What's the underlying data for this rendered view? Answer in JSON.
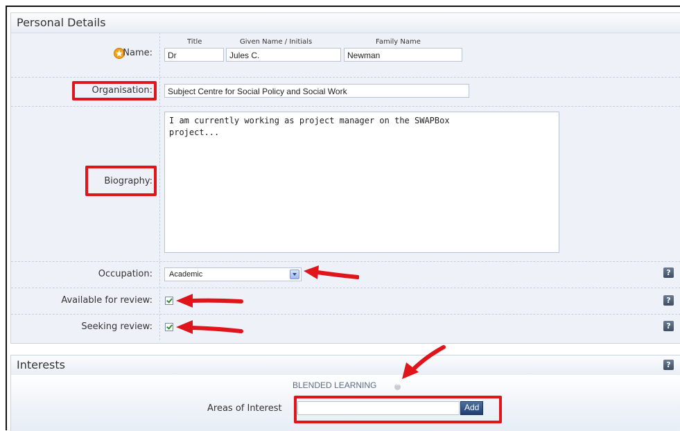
{
  "personal_details": {
    "title": "Personal Details",
    "name": {
      "label": "Name:",
      "title_header": "Title",
      "given_header": "Given Name / Initials",
      "family_header": "Family Name",
      "title_value": "Dr",
      "given_value": "Jules C.",
      "family_value": "Newman"
    },
    "organisation": {
      "label": "Organisation:",
      "value": "Subject Centre for Social Policy and Social Work"
    },
    "biography": {
      "label": "Biography:",
      "value": "I am currently working as project manager on the SWAPBox\nproject..."
    },
    "occupation": {
      "label": "Occupation:",
      "value": "Academic"
    },
    "available_for_review": {
      "label": "Available for review:",
      "checked": true
    },
    "seeking_review": {
      "label": "Seeking review:",
      "checked": true
    },
    "help_glyph": "?"
  },
  "interests": {
    "title": "Interests",
    "tags": [
      "BLENDED LEARNING"
    ],
    "areas_label": "Areas of Interest",
    "areas_value": "",
    "add_label": "Add"
  },
  "colors": {
    "highlight": "#e0141b",
    "panel_bg": "#eef2f8",
    "help_bg": "#4b5d74"
  },
  "icons": {
    "required": "star-icon",
    "help": "help-icon",
    "remove": "remove-tag-icon",
    "annotation": "red-arrow"
  }
}
